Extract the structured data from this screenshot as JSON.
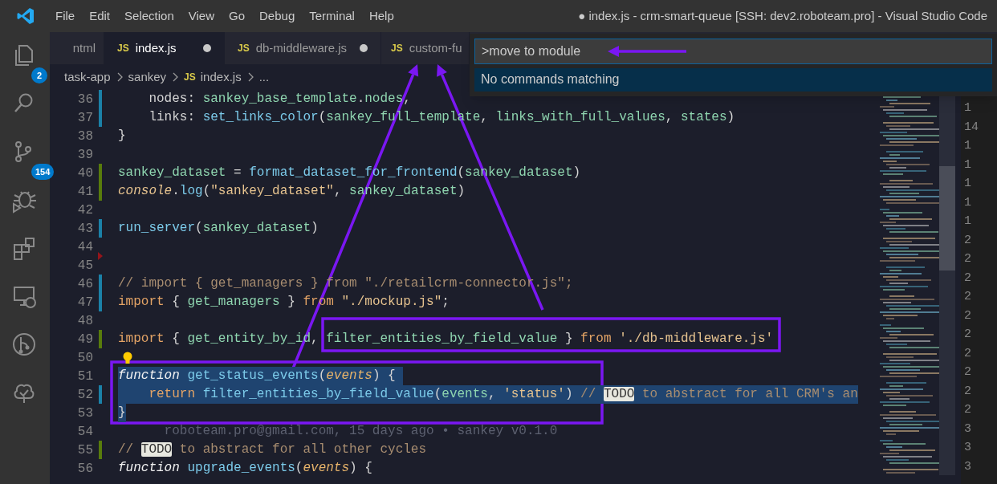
{
  "title_bar": {
    "menu": [
      "File",
      "Edit",
      "Selection",
      "View",
      "Go",
      "Debug",
      "Terminal",
      "Help"
    ],
    "title": "● index.js - crm-smart-queue [SSH: dev2.roboteam.pro] - Visual Studio Code"
  },
  "activity_bar": [
    {
      "kind": "explorer",
      "badge": "2"
    },
    {
      "kind": "search"
    },
    {
      "kind": "source-control",
      "badge": "154"
    },
    {
      "kind": "debug"
    },
    {
      "kind": "extensions"
    },
    {
      "kind": "remote"
    },
    {
      "kind": "git-graph"
    },
    {
      "kind": "tree"
    }
  ],
  "tabs": [
    {
      "label": "ntml",
      "selected": false,
      "dirty": false
    },
    {
      "badge": "JS",
      "label": "index.js",
      "selected": true,
      "dirty": true
    },
    {
      "badge": "JS",
      "label": "db-middleware.js",
      "selected": false,
      "dirty": true
    },
    {
      "badge": "JS",
      "label": "custom-fu",
      "selected": false,
      "dirty": false
    }
  ],
  "breadcrumb": [
    {
      "label": "task-app"
    },
    {
      "label": "sankey"
    },
    {
      "badge": "JS",
      "label": "index.js"
    },
    {
      "label": "..."
    }
  ],
  "command_palette": {
    "value": ">move to module",
    "message": "No commands matching"
  },
  "editor": {
    "lines": [
      {
        "number": "36",
        "modified": true,
        "tokens": [
          {
            "kind": "plain",
            "text": "    nodes: "
          },
          {
            "kind": "var",
            "text": "sankey_base_template"
          },
          {
            "kind": "plain",
            "text": "."
          },
          {
            "kind": "var",
            "text": "nodes"
          },
          {
            "kind": "plain",
            "text": ","
          }
        ]
      },
      {
        "number": "37",
        "modified": true,
        "tokens": [
          {
            "kind": "plain",
            "text": "    links: "
          },
          {
            "kind": "func",
            "text": "set_links_color"
          },
          {
            "kind": "plain",
            "text": "("
          },
          {
            "kind": "var",
            "text": "sankey_full_template"
          },
          {
            "kind": "plain",
            "text": ", "
          },
          {
            "kind": "var",
            "text": "links_with_full_values"
          },
          {
            "kind": "plain",
            "text": ", "
          },
          {
            "kind": "var",
            "text": "states"
          },
          {
            "kind": "plain",
            "text": ")"
          }
        ]
      },
      {
        "number": "38",
        "tokens": [
          {
            "kind": "plain",
            "text": "}"
          }
        ]
      },
      {
        "number": "39"
      },
      {
        "number": "40",
        "added": true,
        "tokens": [
          {
            "kind": "var",
            "text": "sankey_dataset"
          },
          {
            "kind": "plain",
            "text": " = "
          },
          {
            "kind": "func",
            "text": "format_dataset_for_frontend"
          },
          {
            "kind": "plain",
            "text": "("
          },
          {
            "kind": "var",
            "text": "sankey_dataset"
          },
          {
            "kind": "plain",
            "text": ")"
          }
        ]
      },
      {
        "number": "41",
        "added": true,
        "tokens": [
          {
            "kind": "object",
            "text": "console"
          },
          {
            "kind": "plain",
            "text": "."
          },
          {
            "kind": "func",
            "text": "log"
          },
          {
            "kind": "plain",
            "text": "("
          },
          {
            "kind": "string",
            "text": "\"sankey_dataset\""
          },
          {
            "kind": "plain",
            "text": ", "
          },
          {
            "kind": "var",
            "text": "sankey_dataset"
          },
          {
            "kind": "plain",
            "text": ")"
          }
        ]
      },
      {
        "number": "42"
      },
      {
        "number": "43",
        "modified": true,
        "tokens": [
          {
            "kind": "func",
            "text": "run_server"
          },
          {
            "kind": "plain",
            "text": "("
          },
          {
            "kind": "var",
            "text": "sankey_dataset"
          },
          {
            "kind": "plain",
            "text": ")"
          }
        ]
      },
      {
        "number": "44",
        "deleted": true
      },
      {
        "number": "45"
      },
      {
        "number": "46",
        "modified": true,
        "tokens": [
          {
            "kind": "comment",
            "text": "// import { get_managers } from \"./retailcrm-connector.js\";"
          }
        ]
      },
      {
        "number": "47",
        "modified": true,
        "tokens": [
          {
            "kind": "keyword",
            "text": "import"
          },
          {
            "kind": "plain",
            "text": " { "
          },
          {
            "kind": "var",
            "text": "get_managers"
          },
          {
            "kind": "plain",
            "text": " } "
          },
          {
            "kind": "keyword",
            "text": "from "
          },
          {
            "kind": "string",
            "text": "\"./mockup.js\""
          },
          {
            "kind": "plain",
            "text": ";"
          }
        ]
      },
      {
        "number": "48"
      },
      {
        "number": "49",
        "added": true,
        "tokens": [
          {
            "kind": "keyword",
            "text": "import"
          },
          {
            "kind": "plain",
            "text": " { "
          },
          {
            "kind": "var",
            "text": "get_entity_by_id"
          },
          {
            "kind": "plain",
            "text": ", "
          },
          {
            "kind": "var",
            "text": "filter_entities_by_field_value"
          },
          {
            "kind": "plain",
            "text": " } "
          },
          {
            "kind": "keyword",
            "text": "from "
          },
          {
            "kind": "string",
            "text": "'./db-middleware.js'"
          }
        ]
      },
      {
        "number": "50",
        "lightbulb": true
      },
      {
        "number": "51",
        "selected": true,
        "tokens": [
          {
            "kind": "storage",
            "text": "function "
          },
          {
            "kind": "func",
            "text": "get_status_events"
          },
          {
            "kind": "plain",
            "text": "("
          },
          {
            "kind": "param",
            "text": "events"
          },
          {
            "kind": "plain",
            "text": ") { "
          }
        ]
      },
      {
        "number": "52",
        "selected": true,
        "modified": true,
        "tokens": [
          {
            "kind": "keyword",
            "text": "    return "
          },
          {
            "kind": "func",
            "text": "filter_entities_by_field_value"
          },
          {
            "kind": "plain",
            "text": "("
          },
          {
            "kind": "var",
            "text": "events"
          },
          {
            "kind": "plain",
            "text": ", "
          },
          {
            "kind": "string",
            "text": "'status'"
          },
          {
            "kind": "plain",
            "text": ") "
          },
          {
            "kind": "comment",
            "text": "// "
          },
          {
            "kind": "todo",
            "text": "TODO"
          },
          {
            "kind": "comment",
            "text": " to abstract for all CRM's an"
          }
        ]
      },
      {
        "number": "53",
        "selected": true,
        "tokens": [
          {
            "kind": "plain",
            "text": "}"
          }
        ]
      },
      {
        "number": "54",
        "tokens": [
          {
            "kind": "blame",
            "text": "      roboteam.pro@gmail.com, 15 days ago • sankey v0.1.0"
          }
        ]
      },
      {
        "number": "55",
        "added": true,
        "tokens": [
          {
            "kind": "comment",
            "text": "// "
          },
          {
            "kind": "todo",
            "text": "TODO"
          },
          {
            "kind": "comment",
            "text": " to abstract for all other cycles"
          }
        ]
      },
      {
        "number": "56",
        "tokens": [
          {
            "kind": "storage",
            "text": "function "
          },
          {
            "kind": "func",
            "text": "upgrade_events"
          },
          {
            "kind": "plain",
            "text": "("
          },
          {
            "kind": "param",
            "text": "events"
          },
          {
            "kind": "plain",
            "text": ") {"
          }
        ]
      }
    ]
  },
  "side_line_numbers": [
    "1",
    "14",
    "1",
    "1",
    "1",
    "1",
    "1",
    "2",
    "2",
    "2",
    "2",
    "2",
    "2",
    "2",
    "2",
    "2",
    "2",
    "3",
    "3",
    "3"
  ]
}
